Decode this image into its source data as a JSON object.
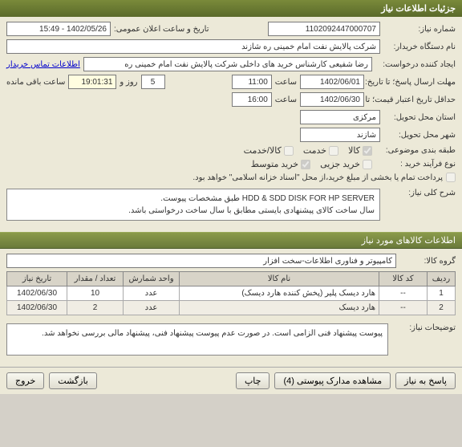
{
  "titlebar": "جزئیات اطلاعات نیاز",
  "section_items": "اطلاعات کالاهای مورد نیاز",
  "labels": {
    "req_no": "شماره نیاز:",
    "pub_date": "تاریخ و ساعت اعلان عمومی:",
    "buyer": "نام دستگاه خریدار:",
    "creator": "ایجاد کننده درخواست:",
    "deadline": "مهلت ارسال پاسخ؛ تا تاریخ:",
    "validity": "حداقل تاریخ اعتبار قیمت؛ تا تاریخ:",
    "delivery_state": "استان محل تحویل:",
    "delivery_city": "شهر محل تحویل:",
    "category": "طبقه بندی موضوعی:",
    "buy_type": "نوع فرآیند خرید :",
    "general_desc": "شرح کلی نیاز:",
    "goods_group": "گروه کالا:",
    "remarks": "توضیحات نیاز:",
    "contact_link": "اطلاعات تماس خریدار",
    "time_lbl": "ساعت",
    "day_and": "روز و",
    "time_left": "ساعت باقی مانده"
  },
  "values": {
    "req_no": "1102092447000707",
    "pub_date": "1402/05/26 - 15:49",
    "buyer": "شرکت پالایش نفت امام خمینی  ره  شازند",
    "creator": "رضا  شفیعی  کارشناس خرید های داخلی  شرکت پالایش نفت امام خمینی  ره",
    "deadline_date": "1402/06/01",
    "deadline_time": "11:00",
    "days_left": "5",
    "countdown": "19:01:31",
    "validity_date": "1402/06/30",
    "validity_time": "16:00",
    "state": "مرکزی",
    "city": "شازند",
    "desc_line1": "HDD & SDD DISK FOR HP SERVER طبق مشخصات پیوست.",
    "desc_line2": "سال ساخت کالای پیشنهادی بایستی مطابق با سال ساخت درخواستی باشد.",
    "goods_group": "کامپیوتر و فناوری اطلاعات-سخت افزار",
    "remarks": "پیوست پیشنهاد فنی الزامی است. در صورت عدم پیوست پیشنهاد فنی، پیشنهاد مالی بررسی نخواهد شد."
  },
  "checkboxes": {
    "goods": "کالا",
    "service": "خدمت",
    "goods_service": "کالا/خدمت",
    "micro": "خرید جزیی",
    "medium": "خرید متوسط"
  },
  "payment_note": "پرداخت تمام یا بخشی از مبلغ خرید،از محل \"اسناد خزانه اسلامی\" خواهد بود.",
  "table": {
    "headers": [
      "ردیف",
      "کد کالا",
      "نام کالا",
      "واحد شمارش",
      "تعداد / مقدار",
      "تاریخ نیاز"
    ],
    "rows": [
      [
        "1",
        "--",
        "هارد دیسک پلیر (پخش کننده هارد دیسک)",
        "عدد",
        "10",
        "1402/06/30"
      ],
      [
        "2",
        "--",
        "هارد دیسک",
        "عدد",
        "2",
        "1402/06/30"
      ]
    ]
  },
  "buttons": {
    "reply": "پاسخ به نیاز",
    "attachments": "مشاهده مدارک پیوستی (4)",
    "print": "چاپ",
    "back": "بازگشت",
    "exit": "خروج"
  }
}
